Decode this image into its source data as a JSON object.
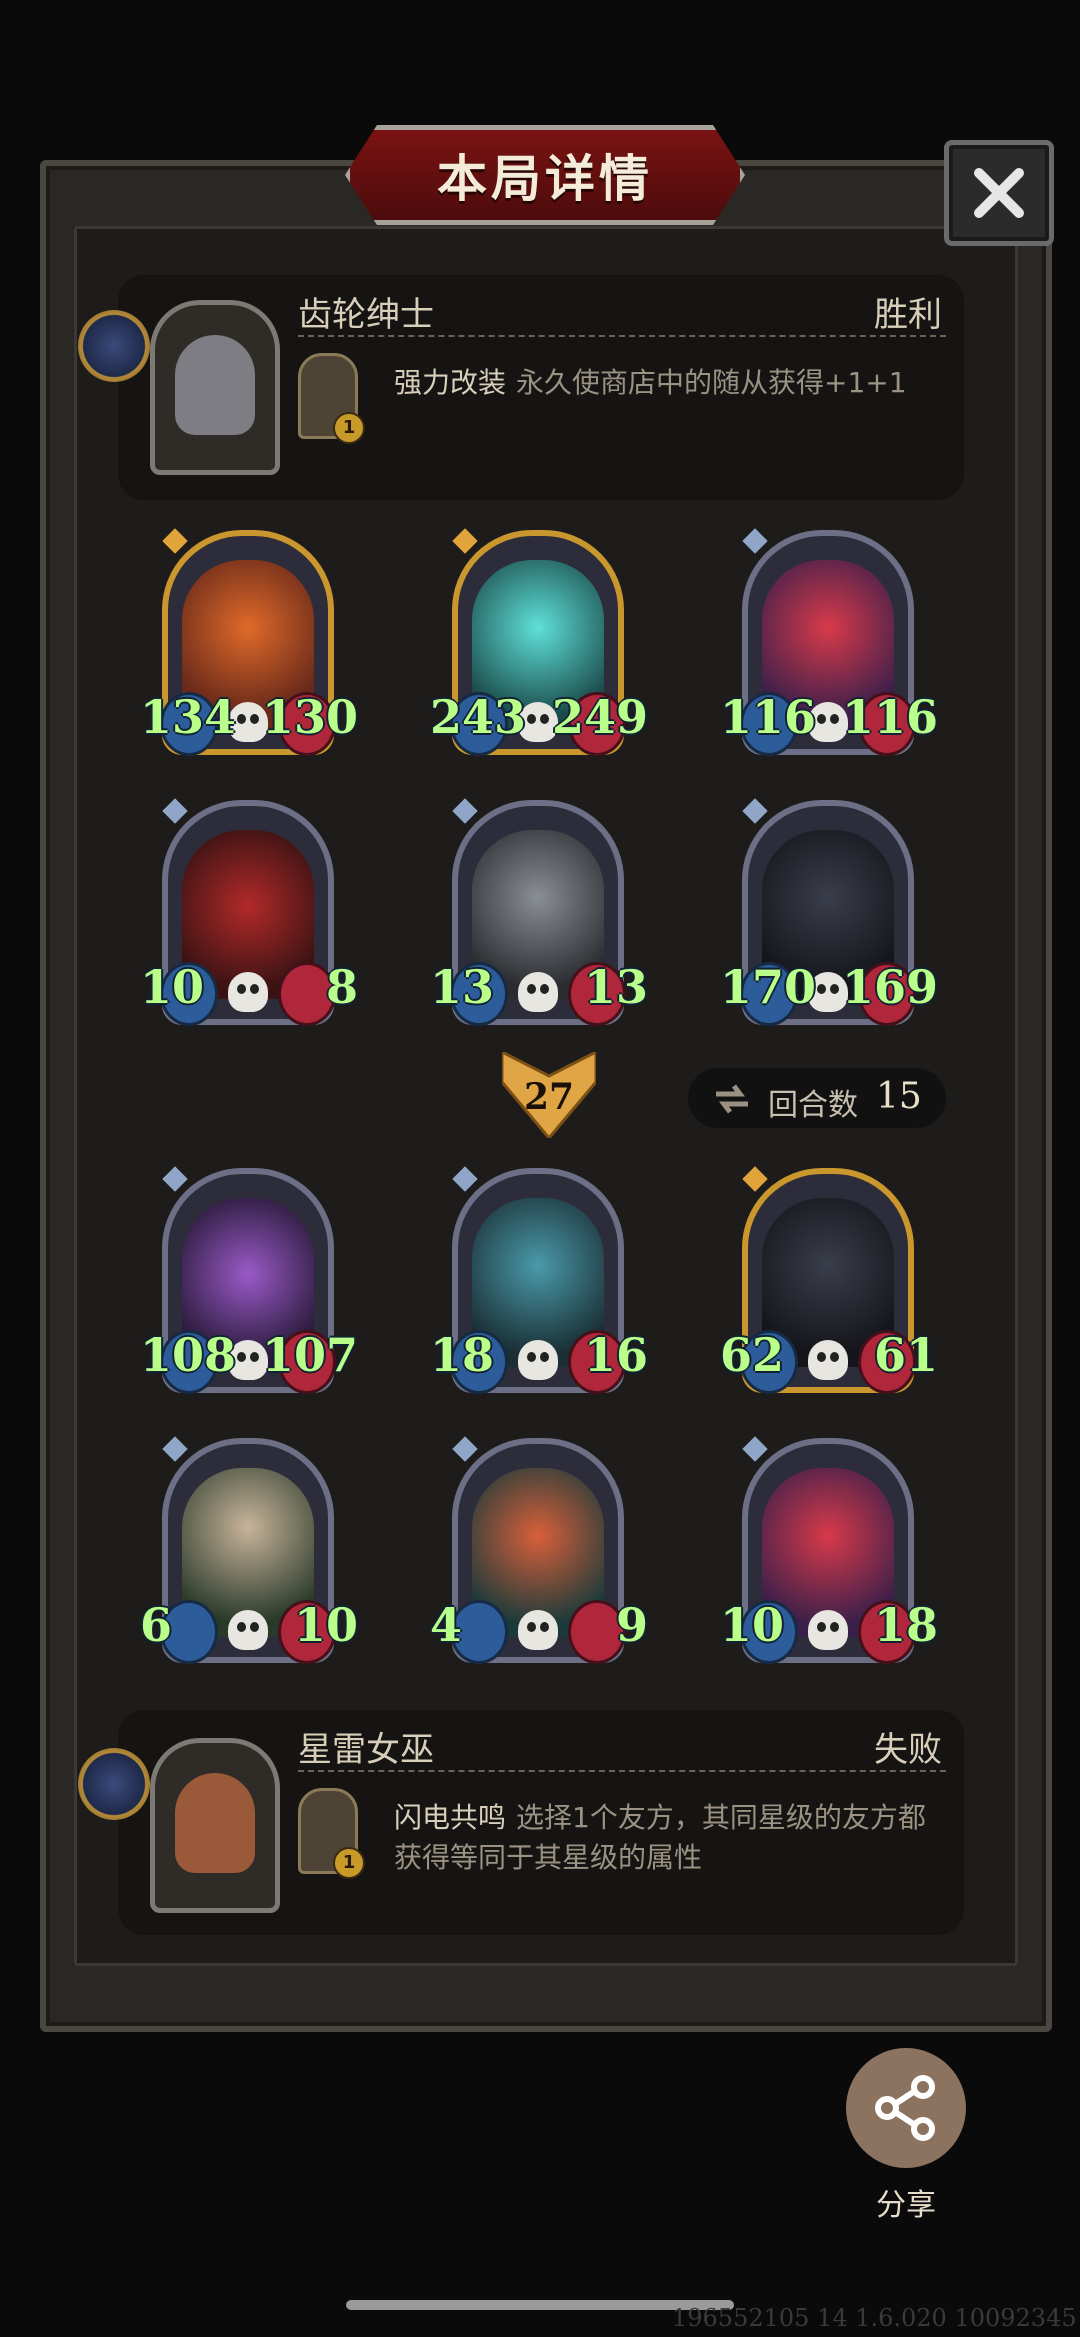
{
  "title": "本局详情",
  "top_player": {
    "name": "齿轮绅士",
    "result": "胜利",
    "skill_level": "1",
    "skill_name": "强力改装",
    "skill_desc": "永久使商店中的随从获得+1+1"
  },
  "bottom_player": {
    "name": "星雷女巫",
    "result": "失败",
    "skill_level": "1",
    "skill_name": "闪电共鸣",
    "skill_desc": "选择1个友方，其同星级的友方都获得等同于其星级的属性"
  },
  "top_board": [
    {
      "atk": "134",
      "hp": "130",
      "tier": "gold",
      "art": "clown"
    },
    {
      "atk": "243",
      "hp": "249",
      "tier": "gold",
      "art": "ghost-warrior"
    },
    {
      "atk": "116",
      "hp": "116",
      "tier": "silver",
      "art": "jester-doll"
    },
    {
      "atk": "10",
      "hp": "8",
      "tier": "silver",
      "art": "red-dragon"
    },
    {
      "atk": "13",
      "hp": "13",
      "tier": "silver",
      "art": "bell-robot"
    },
    {
      "atk": "170",
      "hp": "169",
      "tier": "silver",
      "art": "dark-knight"
    }
  ],
  "bottom_board": [
    {
      "atk": "108",
      "hp": "107",
      "tier": "silver",
      "art": "purple-dragon"
    },
    {
      "atk": "18",
      "hp": "16",
      "tier": "silver",
      "art": "rabbit-doll"
    },
    {
      "atk": "62",
      "hp": "61",
      "tier": "gold",
      "art": "dark-knight"
    },
    {
      "atk": "6",
      "hp": "10",
      "tier": "silver",
      "art": "old-witch"
    },
    {
      "atk": "4",
      "hp": "9",
      "tier": "silver",
      "art": "red-hair-girl"
    },
    {
      "atk": "10",
      "hp": "18",
      "tier": "silver",
      "art": "jester-doll"
    }
  ],
  "wave_count": "27",
  "round_label": "回合数",
  "round_value": "15",
  "share_label": "分享",
  "build_id": "196552105 14 1.6.020 10092345",
  "colors": {
    "frame": "#2a2824",
    "title_red": "#7a1313",
    "stat_green": "#b9ff8a",
    "gold_border": "#c9972e",
    "silver_border": "#6d6f86"
  }
}
